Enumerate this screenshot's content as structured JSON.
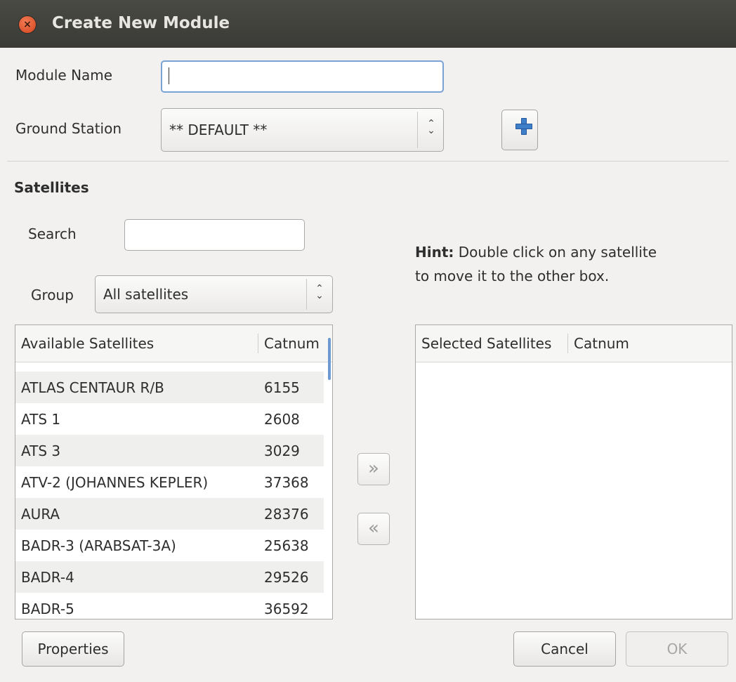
{
  "window": {
    "title": "Create New Module"
  },
  "form": {
    "module_name_label": "Module Name",
    "module_name_value": "",
    "ground_station_label": "Ground Station",
    "ground_station_value": "** DEFAULT **"
  },
  "satellites": {
    "section_title": "Satellites",
    "search_label": "Search",
    "search_value": "",
    "group_label": "Group",
    "group_value": "All satellites",
    "hint_bold": "Hint:",
    "hint_line1": "Double click on any satellite",
    "hint_line2": "to move it to the other box.",
    "available": {
      "col_name": "Available Satellites",
      "col_catnum": "Catnum",
      "rows": [
        {
          "name": "ATLAS CENTAUR R/B",
          "catnum": "6155"
        },
        {
          "name": "ATS 1",
          "catnum": "2608"
        },
        {
          "name": "ATS 3",
          "catnum": "3029"
        },
        {
          "name": "ATV-2 (JOHANNES KEPLER)",
          "catnum": "37368"
        },
        {
          "name": "AURA",
          "catnum": "28376"
        },
        {
          "name": "BADR-3 (ARABSAT-3A)",
          "catnum": "25638"
        },
        {
          "name": "BADR-4",
          "catnum": "29526"
        },
        {
          "name": "BADR-5",
          "catnum": "36592"
        }
      ]
    },
    "selected": {
      "col_name": "Selected Satellites",
      "col_catnum": "Catnum",
      "rows": []
    }
  },
  "buttons": {
    "properties": "Properties",
    "cancel": "Cancel",
    "ok": "OK"
  },
  "icons": {
    "close": "close-icon",
    "add_ground_station": "plus-icon",
    "move_right": "double-chevron-right-icon",
    "move_left": "double-chevron-left-icon"
  },
  "colors": {
    "titlebar": "#3c3b37",
    "close_button": "#e3581f",
    "accent": "#3d7fc8"
  }
}
